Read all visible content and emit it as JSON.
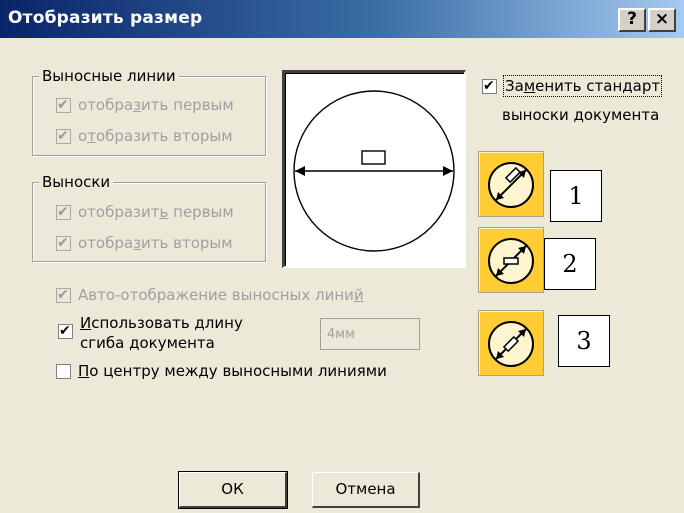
{
  "window": {
    "title": "Отобразить размер",
    "help_label": "?",
    "close_label": "×"
  },
  "ext_lines": {
    "legend": "Выносные линии",
    "show_first": {
      "pre": "отобра",
      "u": "з",
      "post": "ить первым",
      "checked": true,
      "enabled": false
    },
    "show_second": {
      "pre": "о",
      "u": "т",
      "post": "образить вторым",
      "checked": true,
      "enabled": false
    }
  },
  "leaders": {
    "legend": "Выноски",
    "show_first": {
      "pre": "отобразит",
      "u": "ь",
      "post": " первым",
      "checked": true,
      "enabled": false
    },
    "show_second": {
      "pre": "отобра",
      "u": "з",
      "post": "ить вторым",
      "checked": true,
      "enabled": false
    }
  },
  "options": {
    "auto_display": {
      "pre": "Авто-отображение выносных лини",
      "u": "й",
      "post": "",
      "checked": true,
      "enabled": false
    },
    "use_bend": {
      "u": "И",
      "line1": "спользовать длину",
      "line2": "сгиба документа",
      "checked": true,
      "enabled": true
    },
    "bend_value": "4мм",
    "center": {
      "u": "П",
      "post": "о центру между выносными линиями",
      "checked": false,
      "enabled": true
    }
  },
  "replace": {
    "pre": "За",
    "u": "м",
    "post": "енить стандарт",
    "line2": "выноски документа",
    "checked": true
  },
  "icon_buttons": [
    {
      "icon": "diameter-text-aligned-icon",
      "number": "1"
    },
    {
      "icon": "diameter-text-horizontal-icon",
      "number": "2"
    },
    {
      "icon": "diameter-text-inline-icon",
      "number": "3"
    }
  ],
  "buttons": {
    "ok": "ОК",
    "cancel": "Отмена"
  }
}
